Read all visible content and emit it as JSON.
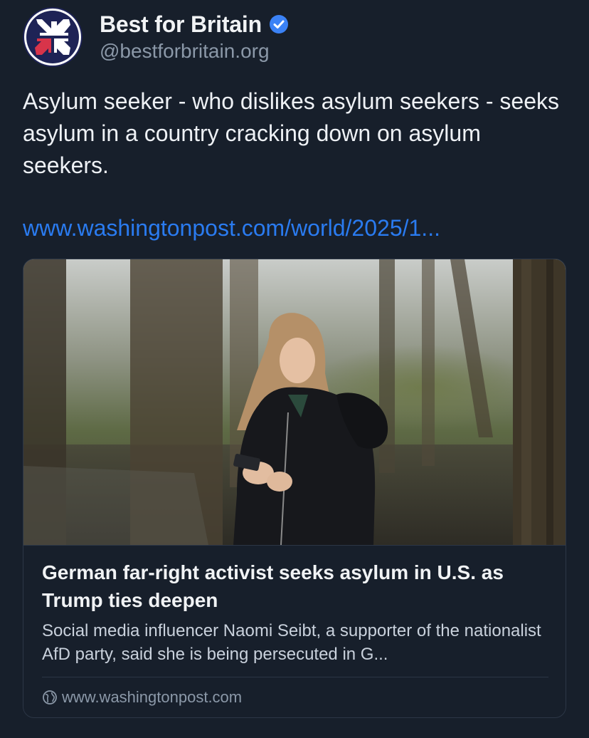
{
  "author": {
    "display_name": "Best for Britain",
    "handle": "@bestforbritain.org",
    "verified": true,
    "avatar_icon": "union-flag-arrows-logo",
    "verified_icon": "verified-check-icon"
  },
  "post": {
    "text": "Asylum seeker - who dislikes asylum seekers - seeks asylum in a country cracking down on asylum seekers.",
    "link_text": "www.washingtonpost.com/world/2025/1..."
  },
  "link_card": {
    "title": "German far-right activist seeks asylum in U.S. as Trump ties deepen",
    "description": "Social media influencer Naomi Seibt, a supporter of the nationalist AfD party, said she is being persecuted in G...",
    "source": "www.washingtonpost.com",
    "source_icon": "globe-icon"
  },
  "colors": {
    "background": "#171f2b",
    "link": "#2a7bf0",
    "verified": "#3b82f6",
    "secondary_text": "#8b98a8",
    "avatar_navy": "#1e2356",
    "avatar_red": "#d8344a"
  }
}
